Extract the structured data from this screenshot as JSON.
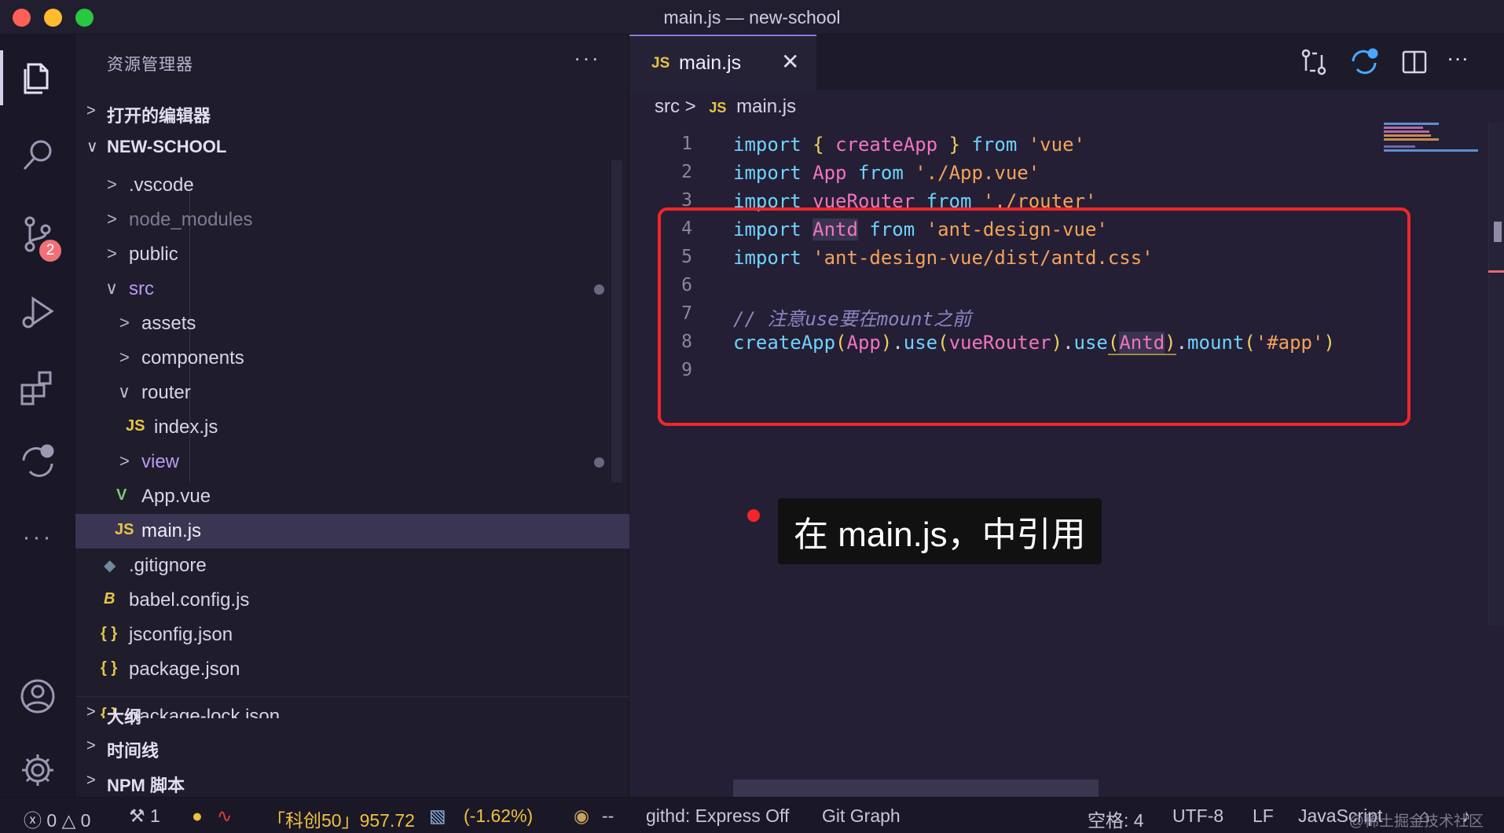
{
  "window": {
    "title": "main.js — new-school"
  },
  "activity_bar": {
    "items": [
      {
        "name": "explorer-icon"
      },
      {
        "name": "search-icon"
      },
      {
        "name": "source-control-icon"
      },
      {
        "name": "run-debug-icon"
      },
      {
        "name": "extensions-icon"
      },
      {
        "name": "diff-icon"
      },
      {
        "name": "more-icon"
      },
      {
        "name": "account-icon"
      },
      {
        "name": "settings-gear-icon"
      }
    ],
    "scm_badge": "2"
  },
  "sidebar": {
    "title": "资源管理器",
    "more": "···",
    "sections": {
      "open_editors": "打开的编辑器",
      "project": "NEW-SCHOOL",
      "outline": "大纲",
      "timeline": "时间线",
      "npm": "NPM 脚本"
    },
    "tree": [
      {
        "name": ".vscode",
        "type": "folder"
      },
      {
        "name": "node_modules",
        "type": "folder"
      },
      {
        "name": "public",
        "type": "folder"
      },
      {
        "name": "src",
        "type": "folder-open"
      },
      {
        "name": "assets",
        "type": "folder"
      },
      {
        "name": "components",
        "type": "folder"
      },
      {
        "name": "router",
        "type": "folder-open"
      },
      {
        "name": "index.js",
        "type": "js"
      },
      {
        "name": "view",
        "type": "folder"
      },
      {
        "name": "App.vue",
        "type": "vue"
      },
      {
        "name": "main.js",
        "type": "js"
      },
      {
        "name": ".gitignore",
        "type": "git"
      },
      {
        "name": "babel.config.js",
        "type": "babel"
      },
      {
        "name": "jsconfig.json",
        "type": "json"
      },
      {
        "name": "package.json",
        "type": "json"
      },
      {
        "name": "package-lock.json",
        "type": "json"
      }
    ]
  },
  "editor": {
    "tab": {
      "icon": "JS",
      "label": "main.js",
      "close": "✕"
    },
    "breadcrumb": {
      "folder": "src",
      "sep": ">",
      "icon": "JS",
      "file": "main.js"
    },
    "line_numbers": [
      "1",
      "2",
      "3",
      "4",
      "5",
      "6",
      "7",
      "8",
      "9"
    ],
    "code": {
      "l1": {
        "kw": "import",
        "b1": "{",
        "v": "createApp",
        "b2": "}",
        "from": "from",
        "s": "'vue'"
      },
      "l2": {
        "kw": "import",
        "v": "App",
        "from": "from",
        "s": "'./App.vue'"
      },
      "l3": {
        "kw": "import",
        "v": "vueRouter",
        "from": "from",
        "s": "'./router'"
      },
      "l4": {
        "kw": "import",
        "v": "Antd",
        "from": "from",
        "s": "'ant-design-vue'"
      },
      "l5": {
        "kw": "import",
        "s": "'ant-design-vue/dist/antd.css'"
      },
      "l7": {
        "c": "// 注意use要在mount之前"
      },
      "l8": {
        "f1": "createApp",
        "p1": "(",
        "a1": "App",
        "p2": ")",
        "d1": ".",
        "f2": "use",
        "p3": "(",
        "a2": "vueRouter",
        "p4": ")",
        "d2": ".",
        "f3": "use",
        "p5": "(",
        "a3": "Antd",
        "p6": ")",
        "d3": ".",
        "f4": "mount",
        "p7": "(",
        "s": "'#app'",
        "p8": ")"
      }
    },
    "caption": "在 main.js，中引用"
  },
  "statusbar": {
    "errors": "0",
    "warnings": "0",
    "tools": "1",
    "stock": "「科创50」957.72",
    "change": "(-1.62%)",
    "dashes": "--",
    "githd": "githd: Express Off",
    "git_graph": "Git Graph",
    "spaces": "空格: 4",
    "encoding": "UTF-8",
    "eol": "LF",
    "language": "JavaScript"
  },
  "watermark": "@稀土掘金技术社区"
}
